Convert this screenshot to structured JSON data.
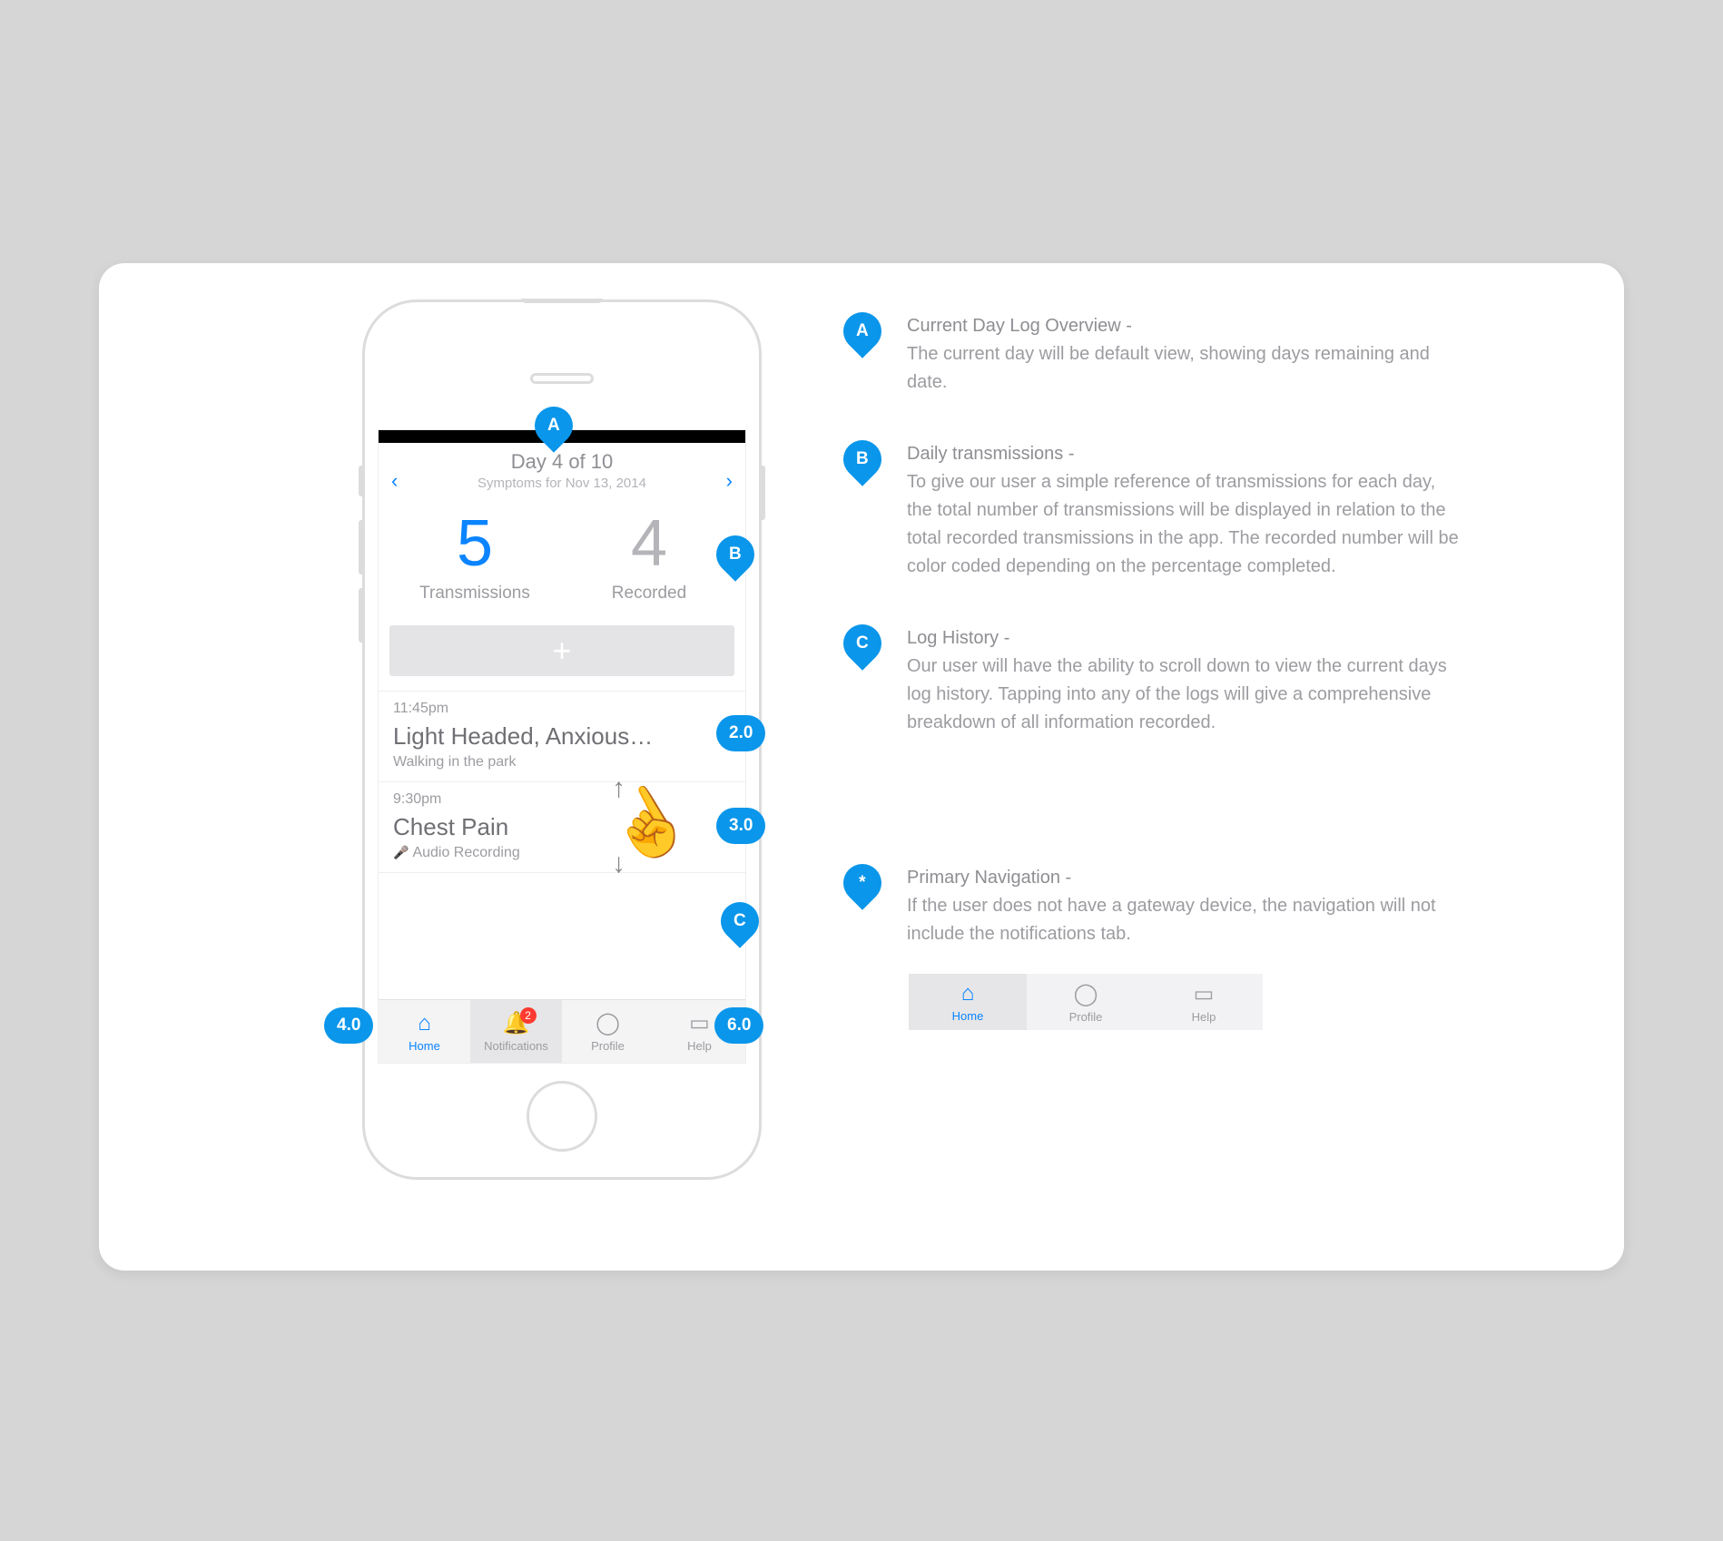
{
  "header": {
    "day_line": "Day 4 of 10",
    "sub_line": "Symptoms for Nov 13, 2014"
  },
  "stats": {
    "transmissions": {
      "value": "5",
      "label": "Transmissions"
    },
    "recorded": {
      "value": "4",
      "label": "Recorded"
    }
  },
  "add_button_glyph": "+",
  "logs": [
    {
      "time": "11:45pm",
      "title": "Light Headed, Anxious…",
      "sub": "Walking in the park",
      "audio": false
    },
    {
      "time": "9:30pm",
      "title": "Chest Pain",
      "sub": "Audio Recording",
      "audio": true
    }
  ],
  "tabs": [
    {
      "icon": "⌂",
      "label": "Home",
      "active": true
    },
    {
      "icon": "🔔",
      "label": "Notifications",
      "active": false,
      "badge": "2"
    },
    {
      "icon": "◯",
      "label": "Profile",
      "active": false
    },
    {
      "icon": "▭",
      "label": "Help",
      "active": false
    }
  ],
  "markers": {
    "A": "A",
    "B": "B",
    "C": "C",
    "m20": "2.0",
    "m30": "3.0",
    "m40": "4.0",
    "m60": "6.0",
    "star": "*"
  },
  "legend": {
    "A": {
      "title": "Current Day Log Overview -",
      "body": "The current day will be default view, showing days remaining and date."
    },
    "B": {
      "title": "Daily transmissions -",
      "body": "To give our user a simple reference of transmissions for each day, the total number of transmissions will be displayed in relation to the total recorded transmissions in the app. The recorded number will be color coded depending on the percentage completed."
    },
    "C": {
      "title": "Log History -",
      "body": "Our user will have the ability to scroll down to view the current days log history. Tapping into any of the logs will give a comprehensive breakdown of all information recorded."
    },
    "star": {
      "title": "Primary Navigation -",
      "body": "If the user does not have a gateway device, the navigation will not include the notifications tab."
    }
  },
  "alt_tabs": [
    {
      "icon": "⌂",
      "label": "Home",
      "active": true
    },
    {
      "icon": "◯",
      "label": "Profile",
      "active": false
    },
    {
      "icon": "▭",
      "label": "Help",
      "active": false
    }
  ]
}
